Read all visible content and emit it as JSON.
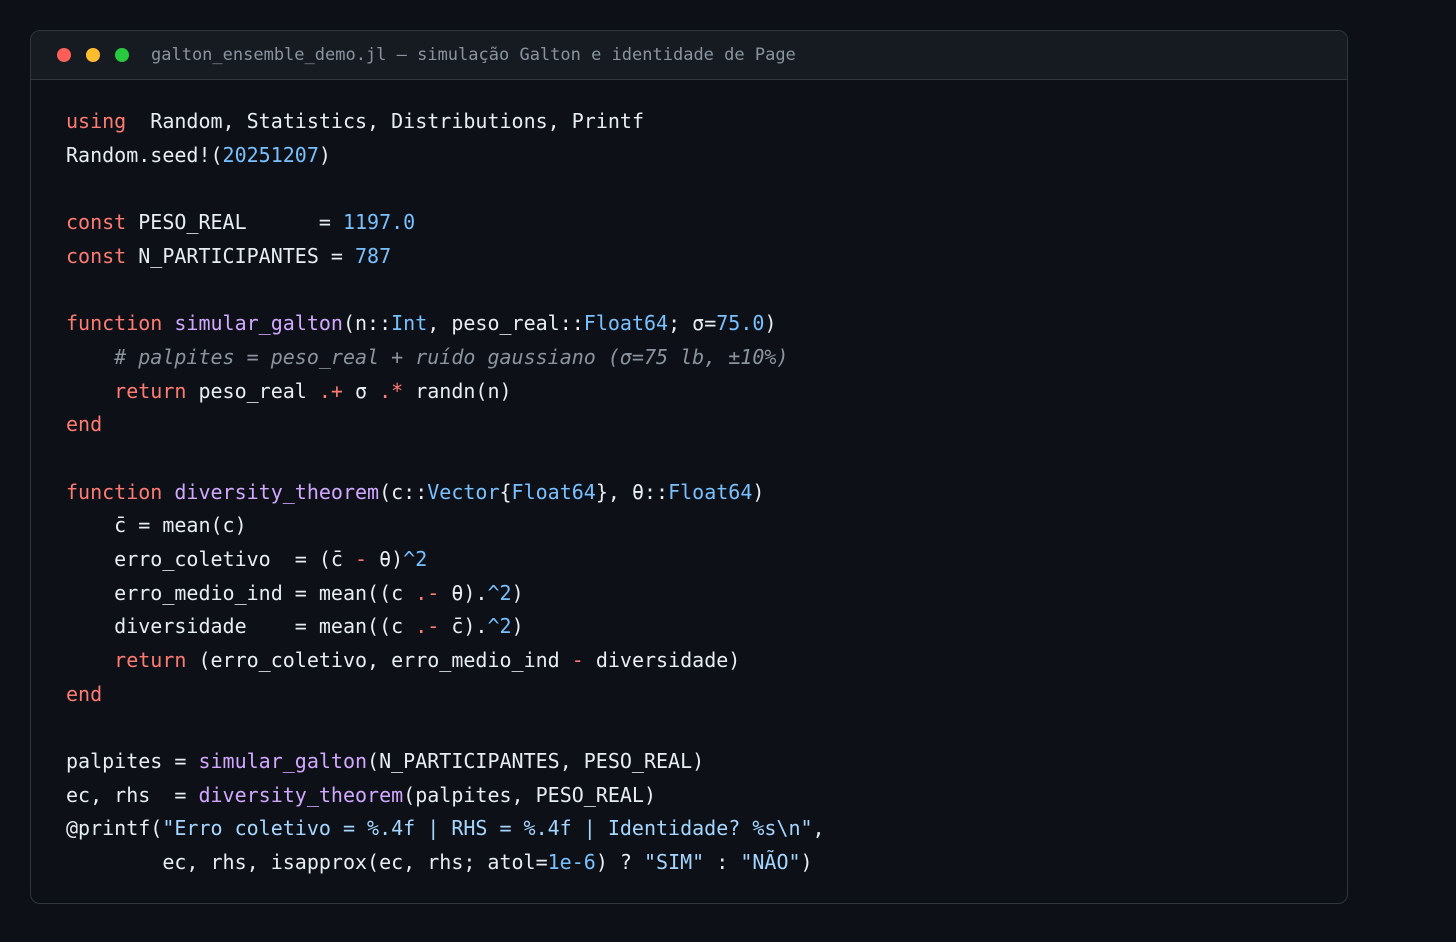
{
  "window": {
    "title": "galton_ensemble_demo.jl — simulação Galton e identidade de Page",
    "controls": [
      "close",
      "minimize",
      "maximize"
    ]
  },
  "colors": {
    "keyword": "#ff7b72",
    "number": "#79c0ff",
    "function": "#d2a8ff",
    "string": "#a5d6ff",
    "comment": "#8b949e",
    "text": "#e6edf3",
    "background": "#0d1117"
  },
  "code": {
    "lines": [
      [
        [
          "kw",
          "using"
        ],
        [
          "",
          "  Random, Statistics, Distributions, Printf"
        ]
      ],
      [
        [
          "",
          "Random.seed!("
        ],
        [
          "num",
          "20251207"
        ],
        [
          "",
          ")"
        ]
      ],
      [],
      [
        [
          "kw",
          "const"
        ],
        [
          "",
          " PESO_REAL      = "
        ],
        [
          "num",
          "1197.0"
        ]
      ],
      [
        [
          "kw",
          "const"
        ],
        [
          "",
          " N_PARTICIPANTES = "
        ],
        [
          "num",
          "787"
        ]
      ],
      [],
      [
        [
          "kw",
          "function"
        ],
        [
          "",
          " "
        ],
        [
          "fn",
          "simular_galton"
        ],
        [
          "",
          "(n::"
        ],
        [
          "type",
          "Int"
        ],
        [
          "",
          ", peso_real::"
        ],
        [
          "type",
          "Float64"
        ],
        [
          "",
          "; σ="
        ],
        [
          "num",
          "75.0"
        ],
        [
          "",
          ")"
        ]
      ],
      [
        [
          "",
          "    "
        ],
        [
          "cm",
          "# palpites = peso_real + ruído gaussiano (σ=75 lb, ±10%)"
        ]
      ],
      [
        [
          "",
          "    "
        ],
        [
          "kw",
          "return"
        ],
        [
          "",
          " peso_real "
        ],
        [
          "op",
          ".+"
        ],
        [
          "",
          " σ "
        ],
        [
          "op",
          ".*"
        ],
        [
          "",
          " randn(n)"
        ]
      ],
      [
        [
          "kw",
          "end"
        ]
      ],
      [],
      [
        [
          "kw",
          "function"
        ],
        [
          "",
          " "
        ],
        [
          "fn",
          "diversity_theorem"
        ],
        [
          "",
          "(c::"
        ],
        [
          "type",
          "Vector"
        ],
        [
          "",
          "{"
        ],
        [
          "type",
          "Float64"
        ],
        [
          "",
          "}, θ::"
        ],
        [
          "type",
          "Float64"
        ],
        [
          "",
          ")"
        ]
      ],
      [
        [
          "",
          "    c̄ = mean(c)"
        ]
      ],
      [
        [
          "",
          "    erro_coletivo  = (c̄ "
        ],
        [
          "op",
          "-"
        ],
        [
          "",
          " θ)"
        ],
        [
          "num",
          "^2"
        ]
      ],
      [
        [
          "",
          "    erro_medio_ind = mean((c "
        ],
        [
          "op",
          ".-"
        ],
        [
          "",
          " θ)."
        ],
        [
          "num",
          "^2"
        ],
        [
          "",
          ")"
        ]
      ],
      [
        [
          "",
          "    diversidade    = mean((c "
        ],
        [
          "op",
          ".-"
        ],
        [
          "",
          " c̄)."
        ],
        [
          "num",
          "^2"
        ],
        [
          "",
          ")"
        ]
      ],
      [
        [
          "",
          "    "
        ],
        [
          "kw",
          "return"
        ],
        [
          "",
          " (erro_coletivo, erro_medio_ind "
        ],
        [
          "op",
          "-"
        ],
        [
          "",
          " diversidade)"
        ]
      ],
      [
        [
          "kw",
          "end"
        ]
      ],
      [],
      [
        [
          "",
          "palpites = "
        ],
        [
          "fn",
          "simular_galton"
        ],
        [
          "",
          "(N_PARTICIPANTES, PESO_REAL)"
        ]
      ],
      [
        [
          "",
          "ec, rhs  = "
        ],
        [
          "fn",
          "diversity_theorem"
        ],
        [
          "",
          "(palpites, PESO_REAL)"
        ]
      ],
      [
        [
          "",
          "@printf("
        ],
        [
          "str",
          "\"Erro coletivo = %.4f | RHS = %.4f | Identidade? %s\\n\""
        ],
        [
          "",
          ","
        ]
      ],
      [
        [
          "",
          "        ec, rhs, isapprox(ec, rhs; atol="
        ],
        [
          "num",
          "1e-6"
        ],
        [
          "",
          ") ? "
        ],
        [
          "str",
          "\"SIM\""
        ],
        [
          "",
          " : "
        ],
        [
          "str",
          "\"NÃO\""
        ],
        [
          "",
          ")"
        ]
      ]
    ]
  }
}
